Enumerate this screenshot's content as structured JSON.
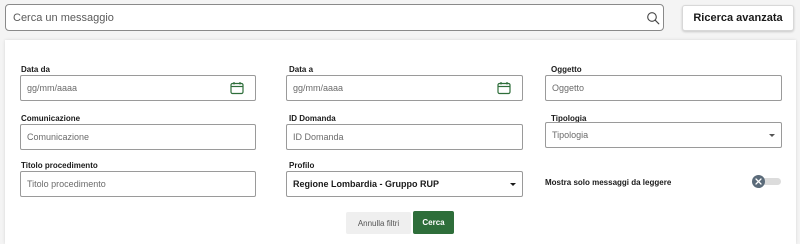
{
  "search": {
    "placeholder": "Cerca un messaggio"
  },
  "advanced_search_label": "Ricerca avanzata",
  "filters": {
    "data_da": {
      "label": "Data da",
      "placeholder": "gg/mm/aaaa"
    },
    "data_a": {
      "label": "Data a",
      "placeholder": "gg/mm/aaaa"
    },
    "oggetto": {
      "label": "Oggetto",
      "placeholder": "Oggetto"
    },
    "comunicazione": {
      "label": "Comunicazione",
      "placeholder": "Comunicazione"
    },
    "id_domanda": {
      "label": "ID Domanda",
      "placeholder": "ID Domanda"
    },
    "tipologia": {
      "label": "Tipologia",
      "placeholder": "Tipologia"
    },
    "titolo_procedimento": {
      "label": "Titolo procedimento",
      "placeholder": "Titolo procedimento"
    },
    "profilo": {
      "label": "Profilo",
      "value": "Regione Lombardia - Gruppo RUP"
    }
  },
  "unread_toggle": {
    "label": "Mostra solo messaggi da leggere",
    "enabled": false
  },
  "actions": {
    "reset_label": "Annulla filtri",
    "search_label": "Cerca"
  },
  "colors": {
    "primary_green": "#2e6e3a",
    "calendar_icon": "#2e6e3a",
    "toggle_knob": "#5b6b7a"
  }
}
